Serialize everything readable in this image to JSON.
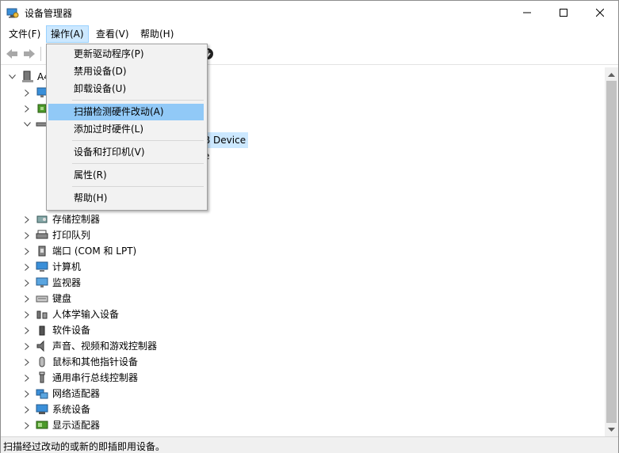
{
  "window": {
    "title": "设备管理器",
    "controls": {
      "minimize": "─",
      "maximize": "☐",
      "close": "✕"
    }
  },
  "menu": {
    "file": "文件(F)",
    "action": "操作(A)",
    "view": "查看(V)",
    "help": "帮助(H)"
  },
  "dropdown": {
    "items": [
      "更新驱动程序(P)",
      "禁用设备(D)",
      "卸载设备(U)",
      "扫描检测硬件改动(A)",
      "添加过时硬件(L)",
      "设备和打印机(V)",
      "属性(R)",
      "帮助(H)"
    ],
    "highlighted_index": 3
  },
  "tree": {
    "root_partial": "A4",
    "partial_selected": "B Device",
    "partial_e": "e",
    "categories": [
      {
        "label": "存储控制器",
        "icon": "storage-controller-icon"
      },
      {
        "label": "打印队列",
        "icon": "printer-icon"
      },
      {
        "label": "端口 (COM 和 LPT)",
        "icon": "port-icon"
      },
      {
        "label": "计算机",
        "icon": "computer-icon"
      },
      {
        "label": "监视器",
        "icon": "monitor-icon"
      },
      {
        "label": "键盘",
        "icon": "keyboard-icon"
      },
      {
        "label": "人体学输入设备",
        "icon": "hid-icon"
      },
      {
        "label": "软件设备",
        "icon": "software-device-icon"
      },
      {
        "label": "声音、视频和游戏控制器",
        "icon": "speaker-icon"
      },
      {
        "label": "鼠标和其他指针设备",
        "icon": "mouse-icon"
      },
      {
        "label": "通用串行总线控制器",
        "icon": "usb-icon"
      },
      {
        "label": "网络适配器",
        "icon": "network-adapter-icon"
      },
      {
        "label": "系统设备",
        "icon": "system-device-icon"
      },
      {
        "label": "显示适配器",
        "icon": "display-adapter-icon"
      }
    ]
  },
  "status": {
    "text": "扫描经过改动的或新的即插即用设备。"
  },
  "colors": {
    "selection": "#cce8ff",
    "menu_highlight": "#91c9f7"
  }
}
